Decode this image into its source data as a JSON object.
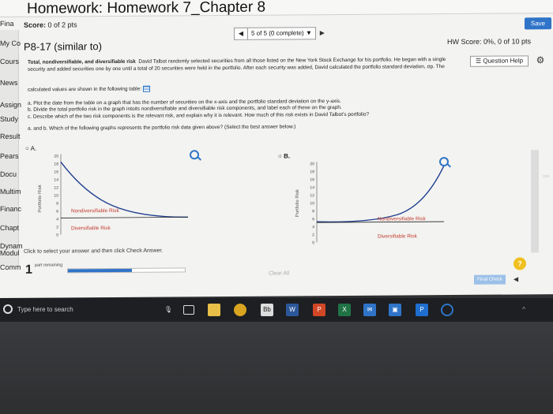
{
  "header": {
    "title": "Homework: Homework 7_Chapter 8",
    "save_label": "Save",
    "score_label": "Score:",
    "score_value": "0 of 2 pts",
    "nav_prev": "◀",
    "nav_select": "5 of 5 (0 complete)",
    "nav_next": "▶",
    "hw_score": "HW Score: 0%, 0 of 10 pts"
  },
  "left_rail": [
    "Fina",
    "My Co",
    "Cours",
    "News",
    "Assign",
    "Study",
    "Result",
    "Pears",
    "Docu",
    "Multim",
    "Financ",
    "Chapt",
    "Dynam Modul",
    "Comm"
  ],
  "problem": {
    "title": "P8-17 (similar to)",
    "question_help": "Question Help",
    "intro_bold": "Total, nondiversifiable, and diversifiable risk",
    "intro_line1": "David Talbot randomly selected securities from all those listed on the New York Stock Exchange for his portfolio. He began with a single",
    "intro_line2": "security and added securities one by one until a total of 20 securities were held in the portfolio. After each security was added, David calculated the portfolio standard deviation, σp. The",
    "intro_line3": "calculated values are shown in the following table:",
    "part_a": "a.  Plot the date from the table on a graph that has the number of securities on the x-axis and the portfolio standard deviation on the y-axis.",
    "part_b": "b.  Divide the total portfolio risk in the graph intoits nondiversifiable and diversifiable risk components, and label each of these on the graph.",
    "part_c": "c.  Describe which of the two risk components is the relevant risk, and explain why it is relevant. How much of this risk exists in David Talbot's portfolio?",
    "question": "a. and b. Which of the following graphs represents the portfolio risk data given above?  (Select the best answer below.)"
  },
  "options": [
    {
      "label": "A.",
      "ylabel": "Portfolio Risk",
      "ticks": [
        "20",
        "18",
        "16",
        "14",
        "12",
        "10",
        "8",
        "6",
        "4",
        "2",
        "0"
      ],
      "label_nondiv": "Nondiversifiable Risk",
      "label_div": "Diversifiable Risk"
    },
    {
      "label": "B.",
      "ylabel": "Portfolio Risk",
      "ticks": [
        "20",
        "18",
        "16",
        "14",
        "12",
        "10",
        "8",
        "6",
        "4",
        "2",
        "0"
      ],
      "label_nondiv": "Nondiversifiable Risk",
      "label_div": "Diversifiable Risk"
    }
  ],
  "footer": {
    "instruction": "Click to select your answer and then click Check Answer.",
    "parts_count": "1",
    "parts_label": "part remaining",
    "progress_fraction": 0.55,
    "clear_all": "Clear All",
    "final_check": "Final Check",
    "help": "?"
  },
  "taskbar": {
    "search_placeholder": "Type here to search",
    "icons": [
      "mic-icon",
      "task-view-icon",
      "file-explorer-icon",
      "chrome-icon",
      "bb-icon",
      "word-icon",
      "powerpoint-icon",
      "excel-icon",
      "mail-icon",
      "store-icon",
      "p-icon",
      "settings-icon"
    ]
  },
  "colors": {
    "accent": "#2f74c8",
    "curve": "#1f3f8f",
    "risk_label": "#c0392b"
  }
}
